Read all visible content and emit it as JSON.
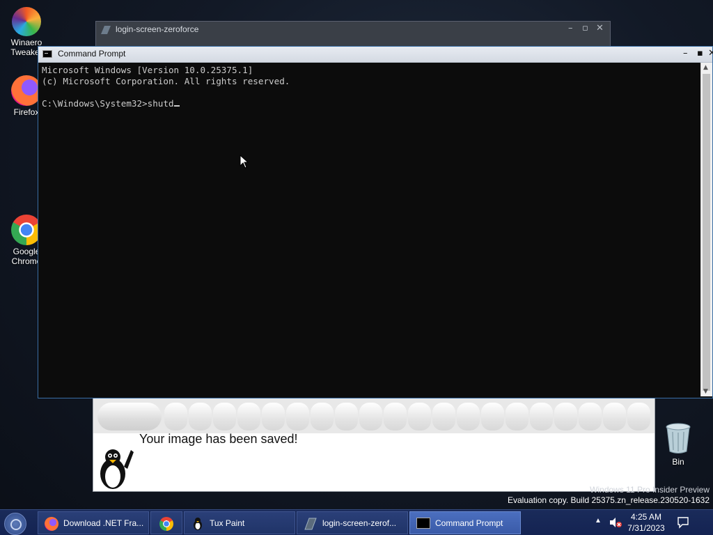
{
  "desktop": {
    "icons": [
      {
        "label_line1": "Winaero",
        "label_line2": "Tweaker"
      },
      {
        "label_line1": "Firefox",
        "label_line2": ""
      },
      {
        "label_line1": "Google",
        "label_line2": "Chrome"
      }
    ],
    "bin_label": "Bin"
  },
  "login_window": {
    "title": "login-screen-zeroforce",
    "minimize": "–",
    "maximize": "▫",
    "close": "✕"
  },
  "cmd_window": {
    "title": "Command Prompt",
    "minimize": "–",
    "maximize": "▪",
    "close": "✕",
    "lines": [
      "Microsoft Windows [Version 10.0.25375.1]",
      "(c) Microsoft Corporation. All rights reserved.",
      "",
      "C:\\Windows\\System32>shutd"
    ]
  },
  "tuxpaint_window": {
    "message": "Your image has been saved!"
  },
  "watermark": {
    "line1": "Windows 11 Pro Insider Preview",
    "line2": "Evaluation copy. Build 25375.zn_release.230520-1632"
  },
  "taskbar": {
    "buttons": [
      {
        "label": "Download .NET Fra...",
        "icon": "firefox-icon",
        "active": false
      },
      {
        "label": "",
        "icon": "chrome-icon",
        "active": false
      },
      {
        "label": "Tux Paint",
        "icon": "tuxpaint-icon",
        "active": false
      },
      {
        "label": "login-screen-zerof...",
        "icon": "app-icon",
        "active": false
      },
      {
        "label": "Command Prompt",
        "icon": "cmd-icon",
        "active": true
      }
    ],
    "tray": {
      "time": "4:25 AM",
      "date": "7/31/2023"
    }
  },
  "colors": {
    "console_bg": "#0c0c0c",
    "console_fg": "#cccccc",
    "taskbar_bg": "#1a2b5a",
    "active_task": "#4b6fbf"
  }
}
